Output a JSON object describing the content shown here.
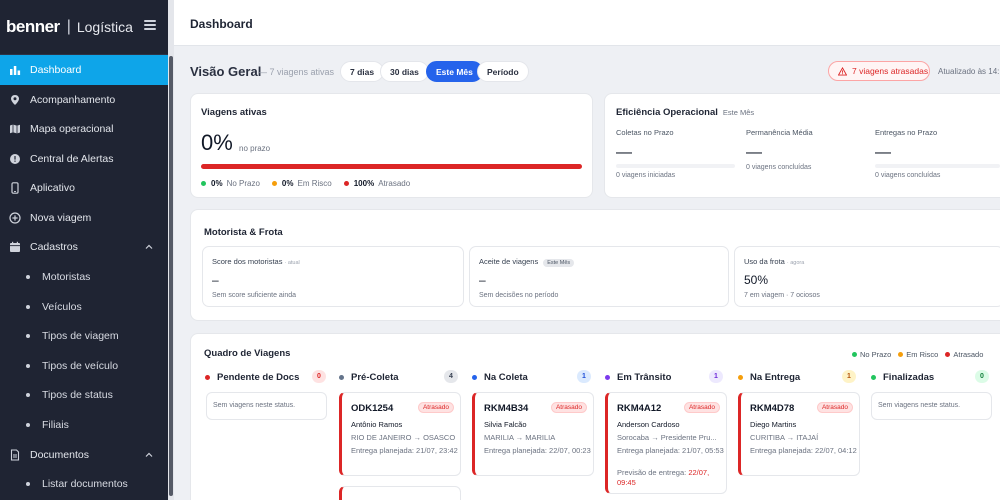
{
  "brand": {
    "logo": "benner",
    "separator": "|",
    "app": "Logística"
  },
  "sidebar": {
    "items": [
      {
        "label": "Dashboard",
        "icon": "bar-chart-icon"
      },
      {
        "label": "Acompanhamento",
        "icon": "map-pin-icon"
      },
      {
        "label": "Mapa operacional",
        "icon": "map-icon"
      },
      {
        "label": "Central de Alertas",
        "icon": "alert-circle-icon"
      },
      {
        "label": "Aplicativo",
        "icon": "smartphone-icon"
      },
      {
        "label": "Nova viagem",
        "icon": "plus-circle-icon"
      },
      {
        "label": "Cadastros",
        "icon": "calendar-icon"
      },
      {
        "label": "Documentos",
        "icon": "file-icon"
      }
    ],
    "cadastros_sub": [
      "Motoristas",
      "Veículos",
      "Tipos de viagem",
      "Tipos de veículo",
      "Tipos de status",
      "Filiais"
    ],
    "documentos_sub": [
      "Listar documentos"
    ]
  },
  "topbar": {
    "title": "Dashboard"
  },
  "overview": {
    "title": "Visão Geral",
    "subtitle": "— 7 viagens ativas",
    "filters": [
      "7 dias",
      "30 dias",
      "Este Mês",
      "Período"
    ],
    "active_filter": "Este Mês",
    "alert": "7 viagens atrasadas",
    "updated": "Atualizado às 14:"
  },
  "viagens_ativas": {
    "title": "Viagens ativas",
    "percent": "0%",
    "percent_label": "no prazo",
    "legend": [
      {
        "value": "0%",
        "label": "No Prazo",
        "color": "#22c55e"
      },
      {
        "value": "0%",
        "label": "Em Risco",
        "color": "#f59e0b"
      },
      {
        "value": "100%",
        "label": "Atrasado",
        "color": "#dc2626"
      }
    ],
    "late_fraction": 1.0
  },
  "eficiencia": {
    "title": "Eficiência Operacional",
    "period": "Este Mês",
    "cols": [
      {
        "label": "Coletas no Prazo",
        "value": "—",
        "foot": "0 viagens iniciadas"
      },
      {
        "label": "Permanência Média",
        "value": "—",
        "foot": "0 viagens concluídas"
      },
      {
        "label": "Entregas no Prazo",
        "value": "—",
        "foot": "0 viagens concluídas"
      }
    ]
  },
  "motorista_frota": {
    "title": "Motorista & Frota",
    "boxes": [
      {
        "label": "Score dos motoristas",
        "tag": "· atual",
        "value": "–",
        "foot": "Sem score suficiente ainda"
      },
      {
        "label": "Aceite de viagens",
        "tag": "Este Mês",
        "value": "–",
        "foot": "Sem decisões no período"
      },
      {
        "label": "Uso da frota",
        "tag": "· agora",
        "value": "50%",
        "foot": "7 em viagem · 7 ociosos"
      }
    ]
  },
  "quadro": {
    "title": "Quadro de Viagens",
    "legend": [
      {
        "label": "No Prazo",
        "color": "#22c55e"
      },
      {
        "label": "Em Risco",
        "color": "#f59e0b"
      },
      {
        "label": "Atrasado",
        "color": "#dc2626"
      }
    ],
    "columns": [
      {
        "name": "Pendente de Docs",
        "count": "0",
        "color": "#dc2626",
        "badge_bg": "#fee2e2",
        "badge_fg": "#dc2626"
      },
      {
        "name": "Pré-Coleta",
        "count": "4",
        "color": "#64748b",
        "badge_bg": "#e5e7eb",
        "badge_fg": "#374151"
      },
      {
        "name": "Na Coleta",
        "count": "1",
        "color": "#2563eb",
        "badge_bg": "#dbeafe",
        "badge_fg": "#1d4ed8"
      },
      {
        "name": "Em Trânsito",
        "count": "1",
        "color": "#7c3aed",
        "badge_bg": "#ede9fe",
        "badge_fg": "#6d28d9"
      },
      {
        "name": "Na Entrega",
        "count": "1",
        "color": "#f59e0b",
        "badge_bg": "#fef3c7",
        "badge_fg": "#b45309"
      },
      {
        "name": "Finalizadas",
        "count": "0",
        "color": "#22c55e",
        "badge_bg": "#dcfce7",
        "badge_fg": "#15803d"
      }
    ],
    "empty_text": "Sem viagens neste status.",
    "cards": [
      {
        "code": "ODK1254",
        "status": "Atrasado",
        "driver": "Antônio Ramos",
        "route": "RIO DE JANEIRO → OSASCO",
        "plan": "Entrega planejada: 21/07, 23:42"
      },
      {
        "code": "RKM4B34",
        "status": "Atrasado",
        "driver": "Silvia Falcão",
        "route": "MARILIA → MARILIA",
        "plan": "Entrega planejada: 22/07, 00:23"
      },
      {
        "code": "RKM4A12",
        "status": "Atrasado",
        "driver": "Anderson Cardoso",
        "route": "Sorocaba → Presidente Pru...",
        "plan": "Entrega planejada: 21/07, 05:53",
        "prev_label": "Previsão de entrega:",
        "prev_value": "22/07, 09:45"
      },
      {
        "code": "RKM4D78",
        "status": "Atrasado",
        "driver": "Diego Martins",
        "route": "CURITIBA → ITAJAÍ",
        "plan": "Entrega planejada: 22/07, 04:12"
      }
    ]
  }
}
